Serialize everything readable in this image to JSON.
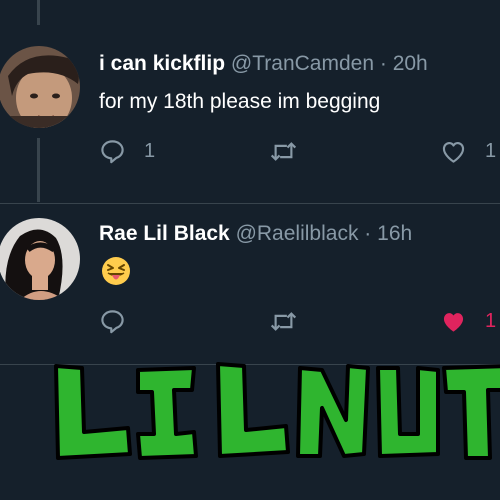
{
  "tweet1": {
    "name": "i can kickflip",
    "handle": "@TranCamden",
    "separator": "·",
    "time": "20h",
    "text": "for my 18th please im begging",
    "reply_count": "1",
    "retweet_count": "",
    "like_count": "1"
  },
  "tweet2": {
    "name": "Rae Lil Black",
    "handle": "@Raelilblack",
    "separator": "·",
    "time": "16h",
    "emoji": "squinting-face-with-tongue",
    "reply_count": "",
    "retweet_count": "",
    "like_count": "1",
    "liked": true
  },
  "caption": {
    "text": "LIL NUT",
    "color": "#2fb52f"
  },
  "colors": {
    "background": "#15202b",
    "muted": "#8899a6",
    "like_active": "#e0245e"
  }
}
